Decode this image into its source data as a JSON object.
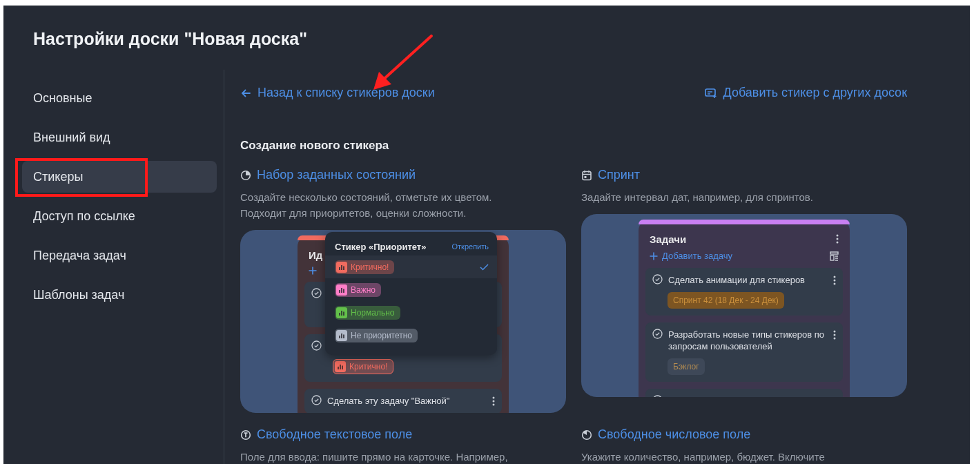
{
  "window": {
    "title": "Настройки доски \"Новая доска\""
  },
  "sidebar": {
    "items": [
      {
        "label": "Основные",
        "selected": false,
        "highlighted": false
      },
      {
        "label": "Внешний вид",
        "selected": false,
        "highlighted": false
      },
      {
        "label": "Стикеры",
        "selected": true,
        "highlighted": true
      },
      {
        "label": "Доступ по ссылке",
        "selected": false,
        "highlighted": false
      },
      {
        "label": "Передача задач",
        "selected": false,
        "highlighted": false
      },
      {
        "label": "Шаблоны задач",
        "selected": false,
        "highlighted": false
      }
    ]
  },
  "back_link": "Назад к списку стикеров доски",
  "add_link": "Добавить стикер с других досок",
  "section_title": "Создание нового стикера",
  "sticker_types": [
    {
      "kind": "states",
      "title": "Набор заданных состояний",
      "description": "Создайте несколько состояний, отметьте их цветом.\nПодходит для приоритетов, оценки сложности.",
      "preview": {
        "color": "#f26b5f",
        "column_title": "Ид",
        "popup": {
          "title": "Стикер «Приоритет»",
          "action": "Открепить",
          "options": [
            {
              "label": "Критично!",
              "color": "#f26b5f",
              "selected": true
            },
            {
              "label": "Важно",
              "color": "#ff7ec8",
              "selected": false
            },
            {
              "label": "Нормально",
              "color": "#63c04a",
              "selected": false
            },
            {
              "label": "Не приоритетно",
              "color": "#b4bccb",
              "selected": false
            }
          ]
        },
        "tasks": [
          {
            "kind": "covered"
          },
          {
            "kind": "task",
            "tag": {
              "kind": "priority",
              "label": "Критично!",
              "color": "#f26b5f"
            }
          },
          {
            "kind": "task",
            "title": "Сделать эту задачу \"Важной\""
          }
        ]
      }
    },
    {
      "kind": "sprint",
      "title": "Спринт",
      "description": "Задайте интервал дат, например, для спринтов.",
      "preview": {
        "color": "#c97ff2",
        "column_title": "Задачи",
        "add_label": "Добавить задачу",
        "tasks": [
          {
            "kind": "task",
            "title": "Сделать анимации для стикеров",
            "tag": {
              "kind": "label",
              "label": "Спринт 42 (18 Дек - 24 Дек)",
              "color": "#7d5522"
            }
          },
          {
            "kind": "task",
            "title": "Разработать новые типы стикеров по запросам пользователей",
            "tag": {
              "kind": "label",
              "label": "Бэклог",
              "color": "#3e4858"
            }
          },
          {
            "kind": "cut"
          }
        ]
      }
    },
    {
      "kind": "text",
      "title": "Свободное текстовое поле",
      "description": "Поле для ввода: пишите прямо на карточке. Например,"
    },
    {
      "kind": "number",
      "title": "Свободное числовое поле",
      "description": "Укажите количество, например, бюджет. Включите"
    }
  ]
}
